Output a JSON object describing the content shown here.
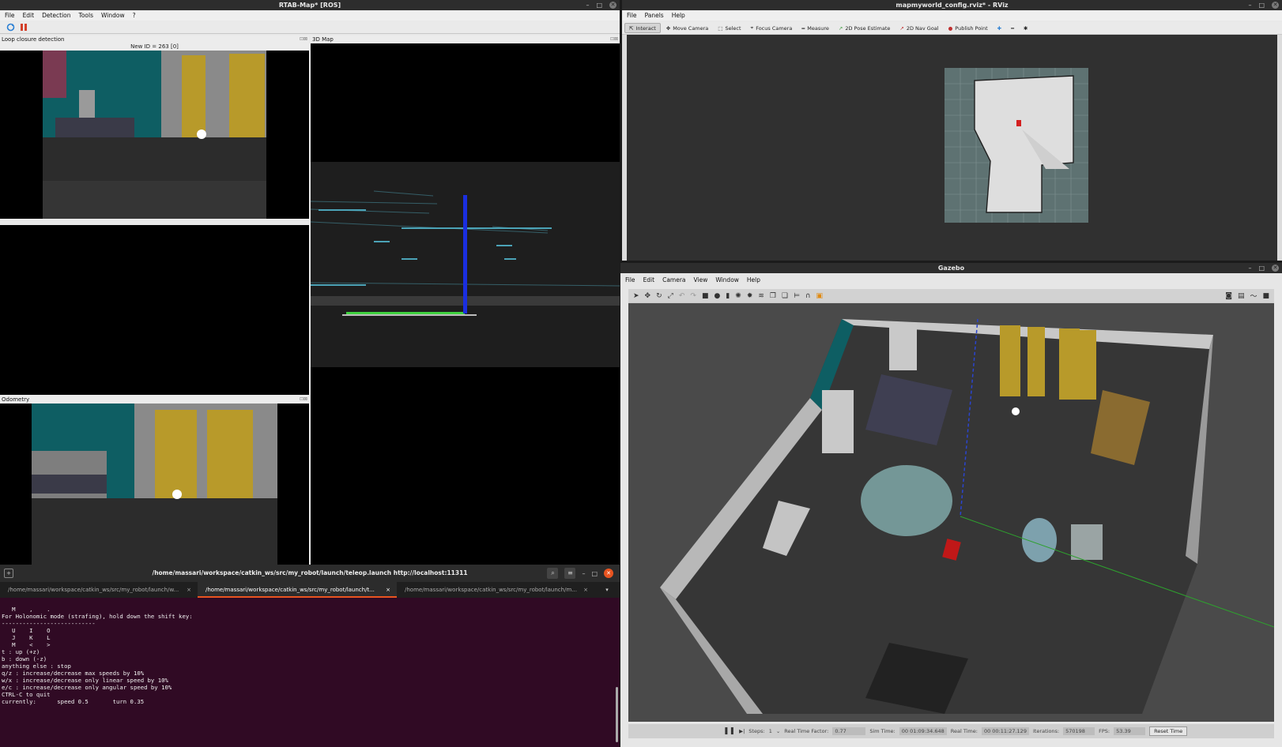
{
  "rtab": {
    "title": "RTAB-Map* [ROS]",
    "menu": [
      "File",
      "Edit",
      "Detection",
      "Tools",
      "Window",
      "?"
    ],
    "loop_title": "Loop closure detection",
    "new_id": "New ID = 263 [0]",
    "map_title": "3D Map",
    "odom_title": "Odometry"
  },
  "rviz": {
    "title": "mapmyworld_config.rviz* - RViz",
    "menu": [
      "File",
      "Panels",
      "Help"
    ],
    "tools": [
      {
        "label": "Interact",
        "icon": "interact-icon"
      },
      {
        "label": "Move Camera",
        "icon": "move-camera-icon"
      },
      {
        "label": "Select",
        "icon": "select-icon"
      },
      {
        "label": "Focus Camera",
        "icon": "focus-camera-icon"
      },
      {
        "label": "Measure",
        "icon": "measure-icon"
      },
      {
        "label": "2D Pose Estimate",
        "icon": "pose-estimate-icon"
      },
      {
        "label": "2D Nav Goal",
        "icon": "nav-goal-icon"
      },
      {
        "label": "Publish Point",
        "icon": "publish-point-icon"
      }
    ]
  },
  "gazebo": {
    "title": "Gazebo",
    "menu": [
      "File",
      "Edit",
      "Camera",
      "View",
      "Window",
      "Help"
    ],
    "status": {
      "steps_label": "Steps:",
      "steps": "1",
      "rtf_label": "Real Time Factor:",
      "rtf": "0.77",
      "sim_label": "Sim Time:",
      "sim": "00 01:09:34.648",
      "real_label": "Real Time:",
      "real": "00 00:11:27.129",
      "iter_label": "Iterations:",
      "iter": "570198",
      "fps_label": "FPS:",
      "fps": "53.39",
      "reset": "Reset Time"
    }
  },
  "terminal": {
    "title": "/home/massari/workspace/catkin_ws/src/my_robot/launch/teleop.launch http://localhost:11311",
    "tabs": [
      "/home/massari/workspace/catkin_ws/src/my_robot/launch/w...",
      "/home/massari/workspace/catkin_ws/src/my_robot/launch/t...",
      "/home/massari/workspace/catkin_ws/src/my_robot/launch/m..."
    ],
    "lines": [
      "   M    ,    .",
      "",
      "For Holonomic mode (strafing), hold down the shift key:",
      "---------------------------",
      "   U    I    O",
      "   J    K    L",
      "   M    <    >",
      "",
      "t : up (+z)",
      "b : down (-z)",
      "",
      "anything else : stop",
      "",
      "q/z : increase/decrease max speeds by 10%",
      "w/x : increase/decrease only linear speed by 10%",
      "e/c : increase/decrease only angular speed by 10%",
      "",
      "CTRL-C to quit",
      "",
      "currently:      speed 0.5       turn 0.35"
    ]
  }
}
